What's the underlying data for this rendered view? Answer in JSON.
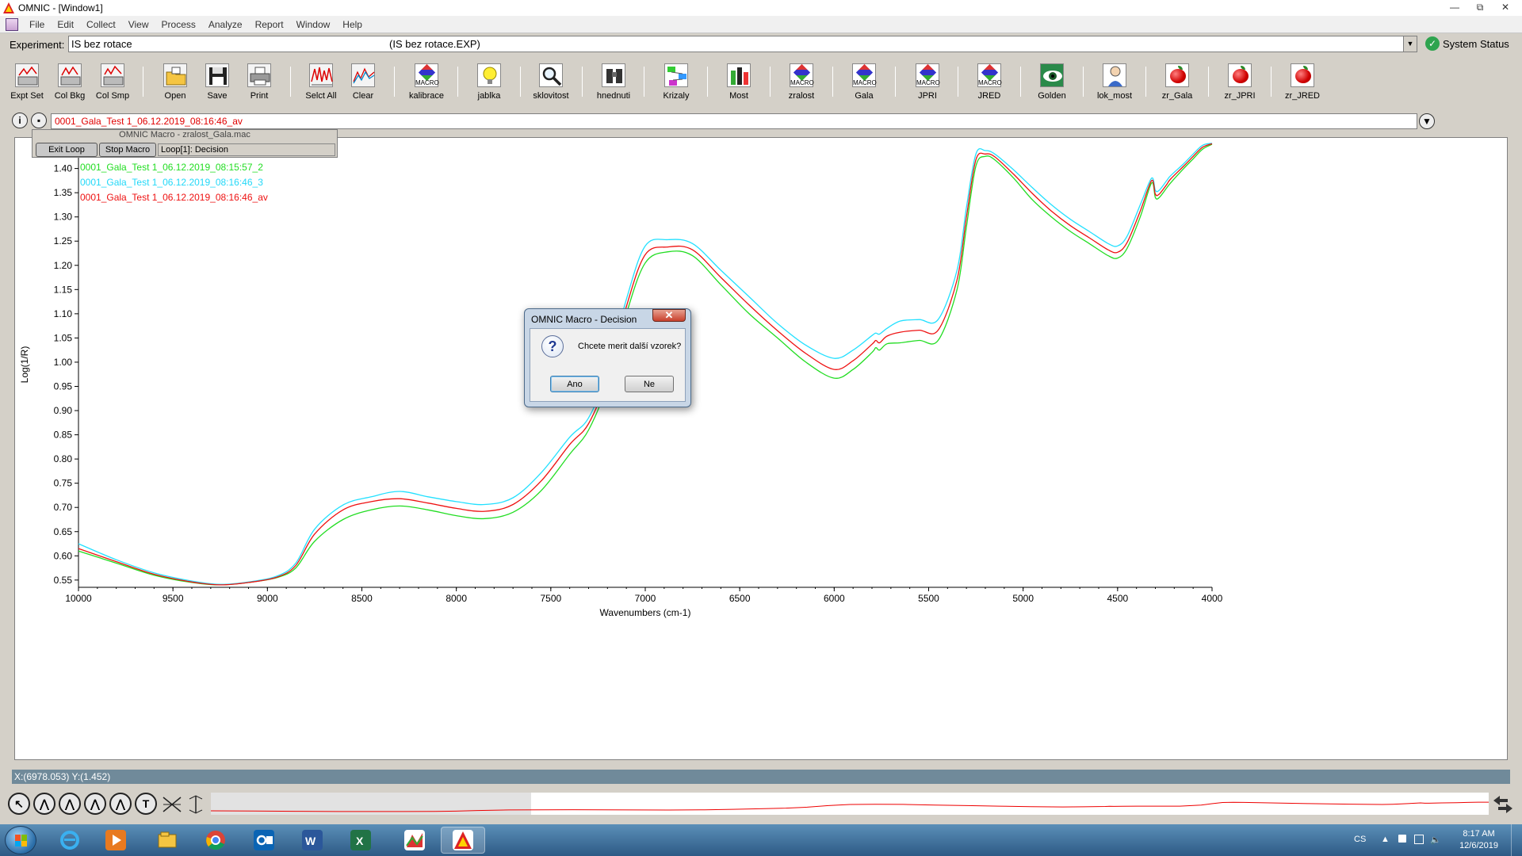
{
  "window": {
    "title": "OMNIC - [Window1]",
    "controls": [
      "—",
      "⧉",
      "✕"
    ]
  },
  "menu": [
    "File",
    "Edit",
    "Collect",
    "View",
    "Process",
    "Analyze",
    "Report",
    "Window",
    "Help"
  ],
  "experiment": {
    "label": "Experiment:",
    "name": "IS bez rotace",
    "file": "(IS bez rotace.EXP)",
    "status": "System Status"
  },
  "toolbar": [
    {
      "label": "Expt Set",
      "icon": "expt-set-icon"
    },
    {
      "label": "Col Bkg",
      "icon": "col-bkg-icon"
    },
    {
      "label": "Col Smp",
      "icon": "col-smp-icon"
    },
    {
      "label": "Open",
      "icon": "open-folder-icon"
    },
    {
      "label": "Save",
      "icon": "save-disk-icon"
    },
    {
      "label": "Print",
      "icon": "printer-icon"
    },
    {
      "label": "Selct All",
      "icon": "select-all-icon"
    },
    {
      "label": "Clear",
      "icon": "clear-icon"
    },
    {
      "label": "kalibrace",
      "icon": "macro-icon"
    },
    {
      "label": "jablka",
      "icon": "lightbulb-icon"
    },
    {
      "label": "sklovitost",
      "icon": "magnifier-icon"
    },
    {
      "label": "hnednuti",
      "icon": "binoculars-icon"
    },
    {
      "label": "Krizaly",
      "icon": "flowchart-icon"
    },
    {
      "label": "Most",
      "icon": "bottles-icon"
    },
    {
      "label": "zralost",
      "icon": "macro-icon"
    },
    {
      "label": "Gala",
      "icon": "macro-icon"
    },
    {
      "label": "JPRI",
      "icon": "macro-icon"
    },
    {
      "label": "JRED",
      "icon": "macro-icon"
    },
    {
      "label": "Golden",
      "icon": "eye-icon"
    },
    {
      "label": "lok_most",
      "icon": "figure-icon"
    },
    {
      "label": "zr_Gala",
      "icon": "apple-icon"
    },
    {
      "label": "zr_JPRI",
      "icon": "apple-icon"
    },
    {
      "label": "zr_JRED",
      "icon": "apple-icon"
    }
  ],
  "macro_icon_text": "MACRO",
  "spectrum_selector": {
    "value": "0001_Gala_Test 1_06.12.2019_08:16:46_av"
  },
  "macro_panel": {
    "title": "OMNIC Macro - zralost_Gala.mac",
    "exit_loop": "Exit Loop",
    "stop_macro": "Stop Macro",
    "status": "Loop[1]: Decision"
  },
  "chart_data": {
    "type": "line",
    "xlabel": "Wavenumbers (cm-1)",
    "ylabel": "Log(1/R)",
    "xlim": [
      10000,
      4000
    ],
    "ylim": [
      0.535,
      1.455
    ],
    "x_ticks": [
      10000,
      9500,
      9000,
      8500,
      8000,
      7500,
      7000,
      6500,
      6000,
      5500,
      5000,
      4500,
      4000
    ],
    "y_ticks": [
      0.55,
      0.6,
      0.65,
      0.7,
      0.75,
      0.8,
      0.85,
      0.9,
      0.95,
      1.0,
      1.05,
      1.1,
      1.15,
      1.2,
      1.25,
      1.3,
      1.35,
      1.4
    ],
    "y_tick_labels": [
      "0.55",
      "0.60",
      "0.65",
      "0.70",
      "0.75",
      "0.80",
      "0.85",
      "0.90",
      "0.95",
      "1.00",
      "1.05",
      "1.10",
      "1.15",
      "1.20",
      "1.25",
      "1.30",
      "1.35",
      "1.40"
    ],
    "series": [
      {
        "name": "0001_Gala_Test 1_06.12.2019_08:15:57_2",
        "color": "#22dd22",
        "x": [
          10000,
          9800,
          9600,
          9400,
          9250,
          9100,
          8950,
          8850,
          8750,
          8600,
          8450,
          8300,
          8150,
          8000,
          7850,
          7700,
          7550,
          7400,
          7300,
          7200,
          7100,
          7000,
          6880,
          6750,
          6600,
          6450,
          6300,
          6150,
          6000,
          5900,
          5800,
          5780,
          5760,
          5720,
          5650,
          5550,
          5450,
          5350,
          5300,
          5250,
          5200,
          5150,
          5050,
          4950,
          4850,
          4750,
          4650,
          4550,
          4500,
          4450,
          4380,
          4320,
          4300,
          4280,
          4240,
          4220,
          4150,
          4100,
          4050,
          4000
        ],
        "y": [
          0.61,
          0.585,
          0.56,
          0.545,
          0.54,
          0.545,
          0.555,
          0.575,
          0.63,
          0.675,
          0.695,
          0.703,
          0.695,
          0.683,
          0.677,
          0.69,
          0.735,
          0.81,
          0.86,
          0.955,
          1.1,
          1.205,
          1.228,
          1.22,
          1.16,
          1.1,
          1.05,
          1.0,
          0.967,
          0.985,
          1.02,
          1.03,
          1.025,
          1.038,
          1.04,
          1.045,
          1.045,
          1.15,
          1.28,
          1.405,
          1.425,
          1.418,
          1.38,
          1.335,
          1.3,
          1.27,
          1.245,
          1.22,
          1.215,
          1.235,
          1.3,
          1.37,
          1.34,
          1.34,
          1.36,
          1.37,
          1.4,
          1.42,
          1.44,
          1.45
        ]
      },
      {
        "name": "0001_Gala_Test 1_06.12.2019_08:16:46_3",
        "color": "#22e0ff",
        "x": [
          10000,
          9800,
          9600,
          9400,
          9250,
          9100,
          8950,
          8850,
          8750,
          8600,
          8450,
          8300,
          8150,
          8000,
          7850,
          7700,
          7550,
          7400,
          7300,
          7200,
          7100,
          7000,
          6880,
          6750,
          6600,
          6450,
          6300,
          6150,
          6000,
          5900,
          5800,
          5780,
          5760,
          5720,
          5650,
          5550,
          5450,
          5350,
          5300,
          5250,
          5200,
          5150,
          5050,
          4950,
          4850,
          4750,
          4650,
          4550,
          4500,
          4450,
          4380,
          4320,
          4300,
          4280,
          4240,
          4220,
          4150,
          4100,
          4050,
          4000
        ],
        "y": [
          0.625,
          0.592,
          0.565,
          0.548,
          0.541,
          0.546,
          0.558,
          0.585,
          0.655,
          0.705,
          0.722,
          0.733,
          0.722,
          0.712,
          0.706,
          0.72,
          0.772,
          0.845,
          0.885,
          0.98,
          1.13,
          1.24,
          1.253,
          1.245,
          1.19,
          1.135,
          1.08,
          1.035,
          1.008,
          1.025,
          1.055,
          1.06,
          1.058,
          1.07,
          1.085,
          1.088,
          1.088,
          1.19,
          1.32,
          1.43,
          1.437,
          1.43,
          1.397,
          1.36,
          1.325,
          1.295,
          1.27,
          1.245,
          1.24,
          1.26,
          1.325,
          1.38,
          1.355,
          1.355,
          1.375,
          1.385,
          1.41,
          1.43,
          1.448,
          1.452
        ]
      },
      {
        "name": "0001_Gala_Test 1_06.12.2019_08:16:46_av",
        "color": "#ee1111",
        "x": [
          10000,
          9800,
          9600,
          9400,
          9250,
          9100,
          8950,
          8850,
          8750,
          8600,
          8450,
          8300,
          8150,
          8000,
          7850,
          7700,
          7550,
          7400,
          7300,
          7200,
          7100,
          7000,
          6880,
          6750,
          6600,
          6450,
          6300,
          6150,
          6000,
          5900,
          5800,
          5780,
          5760,
          5720,
          5650,
          5550,
          5450,
          5350,
          5300,
          5250,
          5200,
          5150,
          5050,
          4950,
          4850,
          4750,
          4650,
          4550,
          4500,
          4450,
          4380,
          4320,
          4300,
          4280,
          4240,
          4220,
          4150,
          4100,
          4050,
          4000
        ],
        "y": [
          0.615,
          0.588,
          0.562,
          0.546,
          0.54,
          0.545,
          0.556,
          0.58,
          0.645,
          0.695,
          0.712,
          0.718,
          0.709,
          0.698,
          0.692,
          0.706,
          0.755,
          0.83,
          0.873,
          0.968,
          1.115,
          1.222,
          1.238,
          1.232,
          1.175,
          1.118,
          1.065,
          1.018,
          0.985,
          1.003,
          1.037,
          1.045,
          1.04,
          1.054,
          1.062,
          1.066,
          1.066,
          1.17,
          1.3,
          1.418,
          1.43,
          1.424,
          1.388,
          1.348,
          1.312,
          1.282,
          1.257,
          1.232,
          1.227,
          1.247,
          1.312,
          1.375,
          1.347,
          1.347,
          1.367,
          1.378,
          1.405,
          1.425,
          1.444,
          1.451
        ]
      }
    ]
  },
  "status_line": "X:(6978.053) Y:(1.452)",
  "dialog": {
    "title": "OMNIC Macro - Decision",
    "question": "Chcete merit další vzorek?",
    "yes": "Ano",
    "no": "Ne",
    "close": "✕"
  },
  "bottom_tools": [
    "↖",
    "⋀",
    "⋀",
    "⋀",
    "⋀",
    "T"
  ],
  "taskbar": {
    "lang": "CS",
    "time": "8:17 AM",
    "date": "12/6/2019"
  }
}
